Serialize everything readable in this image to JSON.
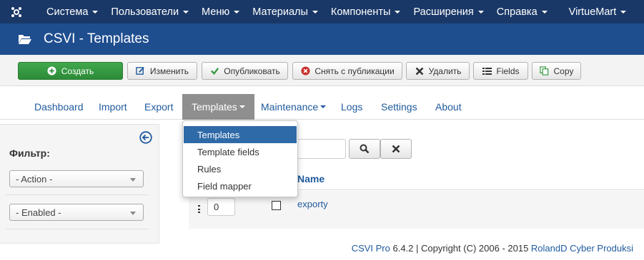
{
  "topnav": {
    "items": [
      {
        "label": "Система",
        "has_caret": true
      },
      {
        "label": "Пользователи",
        "has_caret": true
      },
      {
        "label": "Меню",
        "has_caret": true
      },
      {
        "label": "Материалы",
        "has_caret": true
      },
      {
        "label": "Компоненты",
        "has_caret": true
      },
      {
        "label": "Расширения",
        "has_caret": true
      },
      {
        "label": "Справка",
        "has_caret": true
      },
      {
        "label": "VirtueMart",
        "has_caret": true
      }
    ]
  },
  "header": {
    "icon": "folder-open-icon",
    "title": "CSVI - Templates"
  },
  "toolbar": {
    "create": {
      "label": "Создать",
      "icon": "plus-circle-icon"
    },
    "edit": {
      "label": "Изменить",
      "icon": "edit-icon"
    },
    "publish": {
      "label": "Опубликовать",
      "icon": "check-icon"
    },
    "unpublish": {
      "label": "Снять с публикации",
      "icon": "times-circle-icon"
    },
    "delete": {
      "label": "Удалить",
      "icon": "x-icon"
    },
    "fields": {
      "label": "Fields",
      "icon": "list-icon"
    },
    "copy": {
      "label": "Copy",
      "icon": "copy-icon"
    }
  },
  "subnav": {
    "dashboard": "Dashboard",
    "import": "Import",
    "export": "Export",
    "templates": "Templates",
    "maintenance": "Maintenance",
    "logs": "Logs",
    "settings": "Settings",
    "about": "About",
    "active": "Templates"
  },
  "dropdown": {
    "items": [
      "Templates",
      "Template fields",
      "Rules",
      "Field mapper"
    ],
    "selected": "Templates"
  },
  "sidebar": {
    "filter_label": "Фильтр:",
    "action_select": "- Action -",
    "enabled_select": "- Enabled -"
  },
  "list": {
    "column_name": "Name",
    "rows": [
      {
        "order": "0",
        "name": "exporty",
        "checked": false
      }
    ]
  },
  "footer": {
    "product": "CSVI Pro",
    "copyright": " 6.4.2 | Copyright (C) 2006 - 2015 ",
    "company": "RolandD Cyber Produksi"
  },
  "colors": {
    "topnav_bg": "#1a3867",
    "header_bg": "#1f4e8f",
    "create_btn": "#3a9a44",
    "link": "#1f5a9d",
    "dropdown_selected": "#2f6aa8"
  }
}
